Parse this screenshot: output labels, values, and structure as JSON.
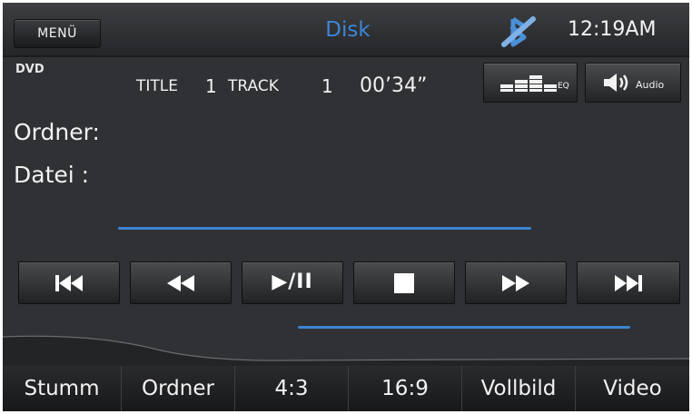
{
  "header": {
    "menu_label": "MENÜ",
    "title": "Disk",
    "clock": "12:19AM",
    "status_icon": "bluetooth-off-icon"
  },
  "info": {
    "source_label": "DVD",
    "title_label": "TITLE",
    "title_number": "1",
    "track_label": "TRACK",
    "track_number": "1",
    "elapsed": "00’34”",
    "folder_label": "Ordner:",
    "file_label": "Datei  :"
  },
  "side_buttons": {
    "eq_label": "EQ",
    "audio_label": "Audio"
  },
  "transport": {
    "play_pause_label": "▶/II",
    "icons": [
      "previous-track-icon",
      "rewind-icon",
      "play-pause-icon",
      "stop-icon",
      "fast-forward-icon",
      "next-track-icon"
    ]
  },
  "bottom_bar": {
    "items": [
      "Stumm",
      "Ordner",
      "4:3",
      "16:9",
      "Vollbild",
      "Video"
    ]
  },
  "colors": {
    "accent": "#3d86d6",
    "background": "#303134"
  }
}
